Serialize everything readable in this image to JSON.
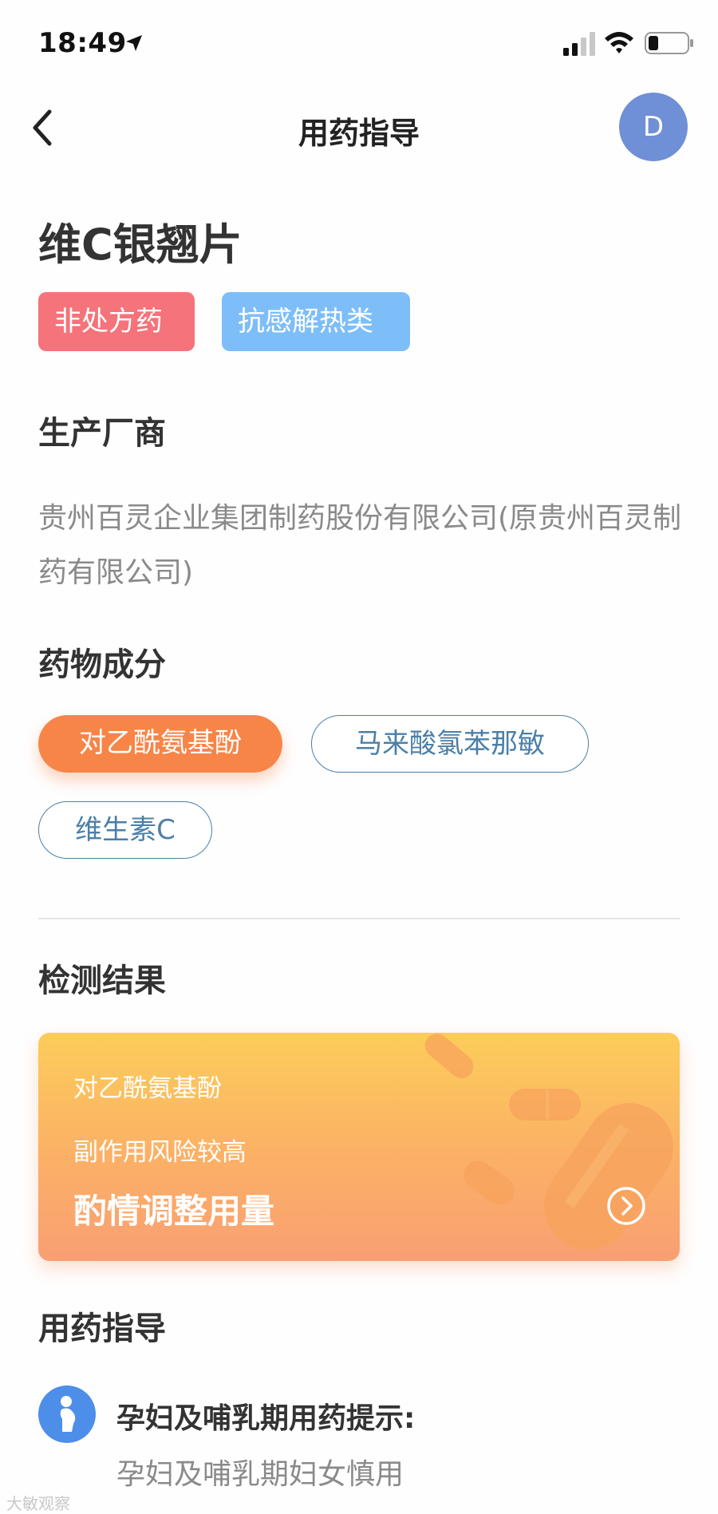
{
  "status_bar": {
    "time": "18:49",
    "icons": [
      "location-arrow-icon",
      "signal-icon",
      "wifi-icon",
      "battery-icon"
    ]
  },
  "nav": {
    "title": "用药指导",
    "avatar_letter": "D",
    "icons": [
      "back-chevron-icon"
    ]
  },
  "drug": {
    "name": "维C银翘片",
    "tags": [
      {
        "label": "非处方药",
        "color": "#f5737a"
      },
      {
        "label": "抗感解热类",
        "color": "#7ebef8"
      }
    ]
  },
  "sections": {
    "manufacturer_title": "生产厂商",
    "manufacturer": "贵州百灵企业集团制药股份有限公司(原贵州百灵制药有限公司)",
    "ingredients_title": "药物成分",
    "ingredients": [
      {
        "label": "对乙酰氨基酚",
        "selected": true
      },
      {
        "label": "马来酸氯苯那敏",
        "selected": false
      },
      {
        "label": "维生素C",
        "selected": false
      }
    ],
    "result_title": "检测结果",
    "guide_title": "用药指导"
  },
  "result_card": {
    "line1": "对乙酰氨基酚",
    "line2": "副作用风险较高",
    "line3": "酌情调整用量",
    "arrow_icon": "chevron-right-circle-icon"
  },
  "guide": {
    "icon": "pregnant-woman-icon",
    "heading": "孕妇及哺乳期用药提示:",
    "text": "孕妇及哺乳期妇女慎用"
  },
  "watermark": "大敏观察",
  "colors": {
    "accent_orange": "#f78548",
    "link_blue": "#4b7fa8",
    "avatar": "#6f8fd6",
    "tag_red": "#f5737a",
    "tag_blue": "#7ebef8"
  }
}
